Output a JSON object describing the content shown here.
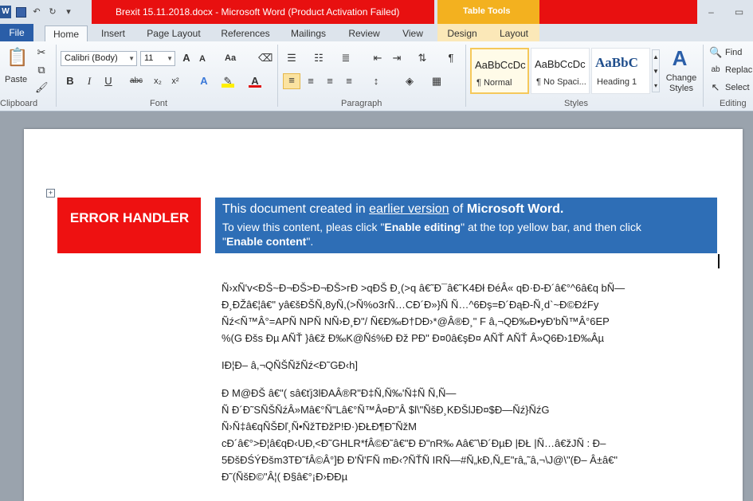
{
  "window": {
    "title": "Brexit 15.11.2018.docx  -  Microsoft Word (Product Activation Failed)",
    "table_tools": "Table Tools"
  },
  "tabs": {
    "file": "File",
    "home": "Home",
    "insert": "Insert",
    "page_layout": "Page Layout",
    "references": "References",
    "mailings": "Mailings",
    "review": "Review",
    "view": "View",
    "design": "Design",
    "layout": "Layout"
  },
  "ribbon": {
    "clipboard": {
      "paste": "Paste",
      "label": "Clipboard"
    },
    "font": {
      "name": "Calibri (Body)",
      "size": "11",
      "label": "Font",
      "change_case": "Aa"
    },
    "paragraph": {
      "label": "Paragraph"
    },
    "styles": {
      "label": "Styles",
      "items": [
        {
          "sample": "AaBbCcDc",
          "name": "¶ Normal"
        },
        {
          "sample": "AaBbCcDc",
          "name": "¶ No Spaci..."
        },
        {
          "sample": "AaBbC",
          "name": "Heading 1"
        }
      ],
      "change_styles": "Change Styles"
    },
    "editing": {
      "label": "Editing",
      "find": "Find",
      "replace": "Replac",
      "select": "Select"
    }
  },
  "document": {
    "error_handler": "ERROR HANDLER",
    "notice_l1_pre": "This document created in ",
    "notice_l1_link": "earlier version",
    "notice_l1_mid": " of ",
    "notice_l1_bold": "Microsoft Word.",
    "notice_l2_pre": "To view this content, pleas click \"",
    "notice_l2_bold": "Enable editing",
    "notice_l2_post": "\" at the top yellow bar, and then click",
    "notice_l3_pre": "\"",
    "notice_l3_bold": "Enable content",
    "notice_l3_post": "\".",
    "garbage": [
      "Ñ›xÑ'v<ÐŠ~Ð¬ÐŠ>Ð¬ÐŠ>гÐ  >qÐŠ Ð¸(>q â€˜Ð¯â€˜K4Ðł ÐéÂ« qÐ·Ð-Ð´â€°^6â€q    bÑ—",
      "Ð¸ÐŽâ€¦â€\" yâ€šÐŠÑ,8yÑ,(>Ñ%o3rÑ…CÐ´Ð»}Ñ  Ñ…^6Ðş=Ð´ÐąÐ-Ñ¸d`~Ð©ÐźFy",
      "Ñź<Ñ™Â°=APÑ  NPÑ  NÑ›Ð¸Ð\"/  Ñ€Ð‰Ð†DÐ›*@Â®Ð¸\"  F          â,¬QÐ‰Ð•yÐ'bÑ™Â°6EP",
      "%(G       Ðšs Ðµ AÑŤ  }â€ž Ð‰K@Ñś%Ð  Ðž  PÐ\" Ð¤0â€şÐ¤ AÑŤ AÑŤ Â»Q6Ð›1Ð‰Âµ",
      "",
      "ІÐ¦Ð–   â,¬QÑŠÑžÑź<Ð˜GÐ‹h]",
      "",
      "Ð M@ÐŠ  â€\"( sâ€ťj3lÐAÂ®R\"Ð‡Ñ,Ñ‰'Ñ‡Ñ  Ñ,Ñ—",
      "Ñ  Ð´Ð˜SÑŠÑźÂ»Mâ€°Ñ\"Lâ€°Ñ™Â¤Ð\"Â  $l\\\"ÑšÐ¸KÐŠlJÐ¤$Ð—Ñź}ÑźG",
      "Ñ›Ñ‡â€qÑŠÐľ¸Ñ•ÑžTÐžP!Ð·)ÐŁÐ¶Ð˜ÑžM",
      "cÐ´â€°>Ð¦â€qÐ‹UÐ‚<Ð˜GHLR*fÂ©Ð˜â€\"Ð  Ð\"nR‰ Aâ€˜\\Ð´ÐµÐ  |ÐŁ  |Ñ…â€žJÑ  : Ð–",
      "5ÐšÐŚÝÐšm3TÐ˜fÂ©Â°]Ð  Ð'Ñ'FÑ  mÐ‹?ÑŤÑ  IRÑ—#Ñ„kÐ,Ñ„E\"râ„˜â,¬\\J@\\\"(Ð–  Â±â€\"",
      "Ð˜(ÑšÐ©\"Â¦(  Ð§â€°¡Ð›ÐÐµ"
    ]
  }
}
